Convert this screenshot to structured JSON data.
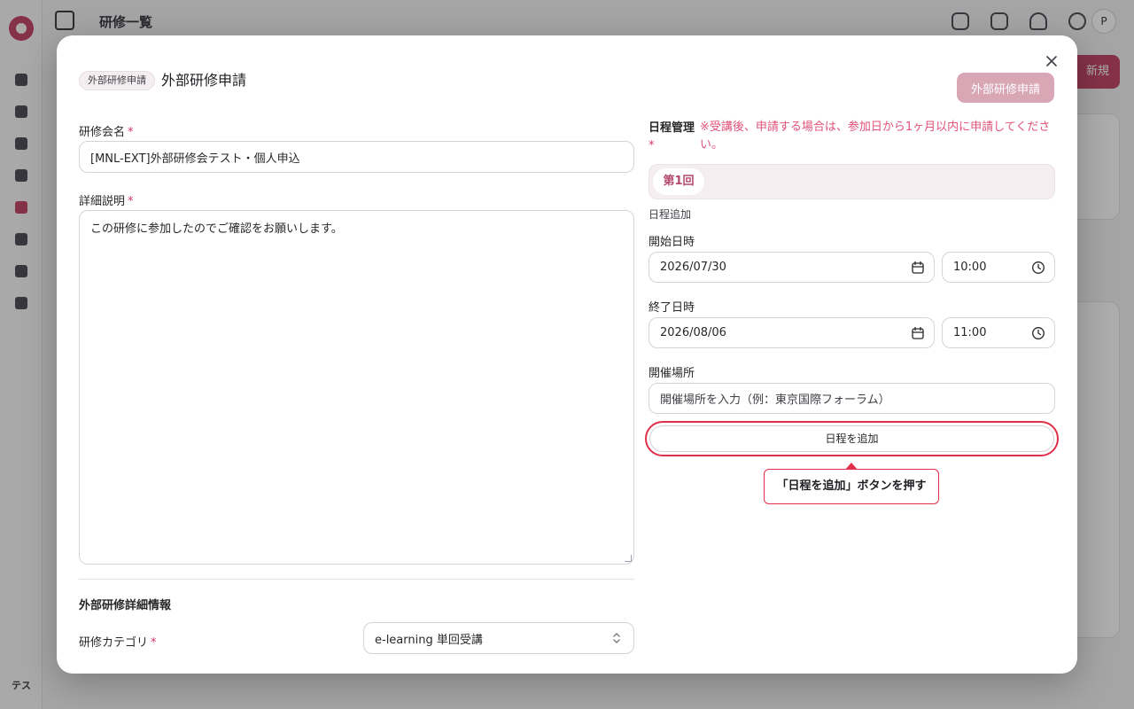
{
  "app": {
    "page_title": "研修一覧",
    "user_initial": "P",
    "bottom_avatar": "テス",
    "bg_button": "新規"
  },
  "modal": {
    "badge": "外部研修申請",
    "title": "外部研修申請",
    "submit_label": "外部研修申請",
    "fields": {
      "training_name_label": "研修会名",
      "training_name_value": "[MNL-EXT]外部研修会テスト・個人申込",
      "description_label": "詳細説明",
      "description_value": "この研修に参加したのでご確認をお願いします。",
      "required_mark": "*"
    },
    "details_section": {
      "title": "外部研修詳細情報",
      "category_label": "研修カテゴリ",
      "category_value": "e-learning 単回受講"
    },
    "schedule": {
      "label": "日程管理",
      "required_mark": "*",
      "note": "※受講後、申請する場合は、参加日から1ヶ月以内に申請してください。",
      "tabs": [
        "第1回"
      ],
      "add_schedule_text": "日程追加",
      "start_label": "開始日時",
      "start_date": "2026/07/30",
      "start_time": "10:00",
      "end_label": "終了日時",
      "end_date": "2026/08/06",
      "end_time": "11:00",
      "venue_label": "開催場所",
      "venue_placeholder": "開催場所を入力（例：東京国際フォーラム）",
      "add_button_label": "日程を追加"
    },
    "callout_text": "「日程を追加」ボタンを押す"
  },
  "colors": {
    "accent": "#c44a6c",
    "highlight_red": "#e0304a",
    "note_pink": "#e0527a",
    "submit_disabled": "#d9a6b5"
  }
}
